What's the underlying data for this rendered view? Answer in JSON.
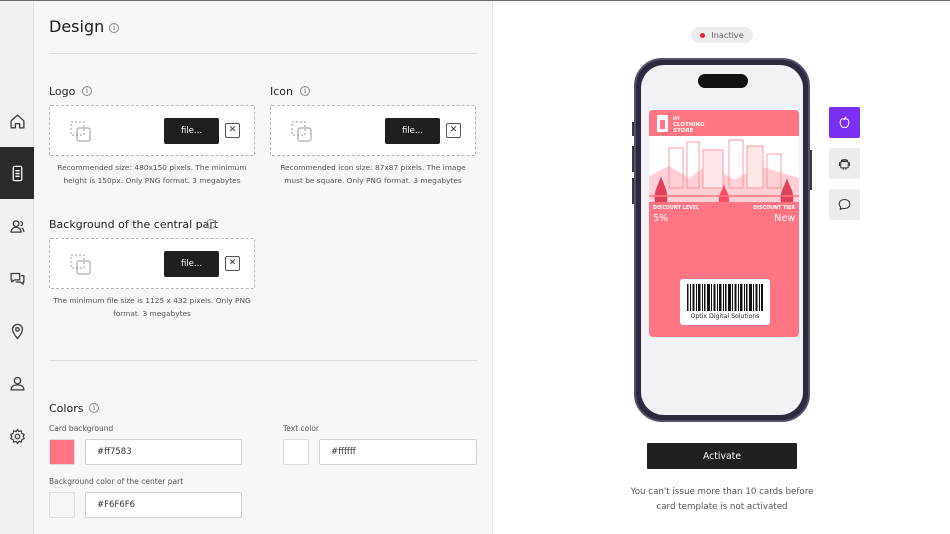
{
  "page": {
    "title": "Design"
  },
  "logo": {
    "label": "Logo",
    "file_button": "file...",
    "hint": "Recommended size: 480x150 pixels. The minimum height is 150px. Only PNG format. 3 megabytes"
  },
  "icon": {
    "label": "Icon",
    "file_button": "file...",
    "hint": "Recommended icon size: 87x87 pixels. The image must be square. Only PNG format. 3 megabytes"
  },
  "background": {
    "label": "Background of the central part",
    "file_button": "file...",
    "hint": "The minimum file size is 1125 x 432 pixels. Only PNG format. 3 megabytes"
  },
  "colors": {
    "label": "Colors",
    "card_background_label": "Card background",
    "card_background_value": "#ff7583",
    "text_color_label": "Text color",
    "text_color_value": "#ffffff",
    "center_bg_label": "Background color of the center part",
    "center_bg_value": "#F6F6F6"
  },
  "preview": {
    "status": "Inactive",
    "card": {
      "brand_small": "MY",
      "brand_line1": "CLOTHING",
      "brand_line2": "STORE",
      "metric_left_label": "DISCOUNT LEVEL",
      "metric_left_value": "5%",
      "metric_right_label": "DISCOUNT TIER",
      "metric_right_value": "New",
      "barcode_text": "Optix Digital Solutions"
    },
    "activate_label": "Activate",
    "notice": "You can't issue more than 10 cards before card template is not activated"
  },
  "palette": {
    "accent": "#7b2ff5",
    "card": "#ff7583",
    "dark": "#202022",
    "status_dot": "#e5272f"
  },
  "icons": {
    "sidebar": [
      "home-icon",
      "phone-card-icon",
      "users-icon",
      "chat-icon",
      "location-icon",
      "profile-icon",
      "settings-icon"
    ],
    "platforms": [
      "apple-icon",
      "android-icon",
      "message-icon"
    ]
  }
}
